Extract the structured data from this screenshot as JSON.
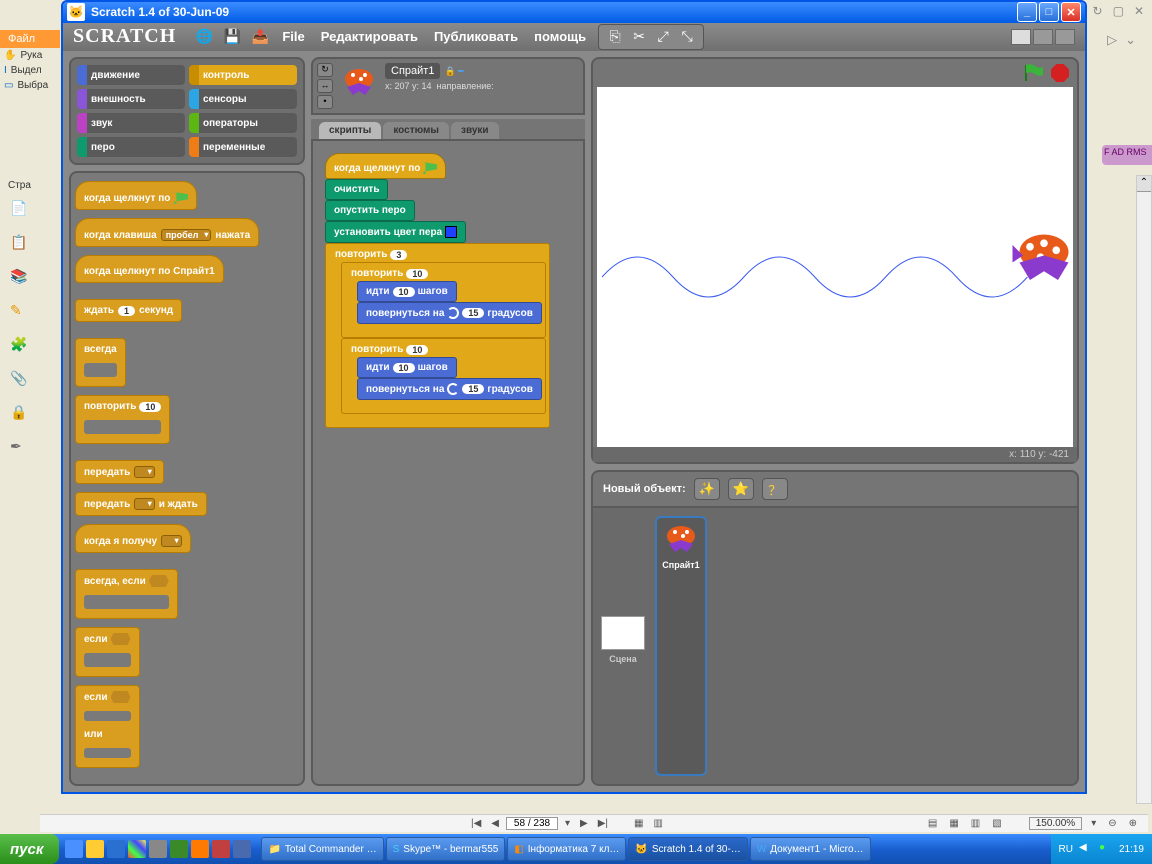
{
  "window": {
    "title": "Scratch 1.4 of 30-Jun-09"
  },
  "bg": {
    "file_tab": "Файл",
    "tools": [
      "Рука",
      "Выдел",
      "Выбра"
    ],
    "stra": "Стра",
    "right_tab": "F\nAD RMS"
  },
  "toolbar": {
    "logo": "SCRATCH",
    "menus": [
      "File",
      "Редактировать",
      "Публиковать",
      "помощь"
    ]
  },
  "categories": {
    "motion": "движение",
    "control": "контроль",
    "looks": "внешность",
    "sensing": "сенсоры",
    "sound": "звук",
    "operators": "операторы",
    "pen": "перо",
    "variables": "переменные"
  },
  "palette": {
    "when_flag": "когда щелкнут по",
    "when_key_1": "когда клавиша",
    "when_key_sel": "пробел",
    "when_key_2": "нажата",
    "when_sprite": "когда щелкнут по  Спрайт1",
    "wait_1": "ждать",
    "wait_val": "1",
    "wait_2": "секунд",
    "forever": "всегда",
    "repeat": "повторить",
    "repeat_val": "10",
    "broadcast": "передать",
    "broadcast_wait_1": "передать",
    "broadcast_wait_2": "и ждать",
    "receive": "когда я получу",
    "forever_if": "всегда, если",
    "if": "если",
    "if_else_if": "если",
    "if_else_else": "или"
  },
  "sprite": {
    "name": "Спрайт1",
    "pos": "x: 207  y: 14",
    "dir_label": "направление:"
  },
  "tabs": {
    "scripts": "скрипты",
    "costumes": "костюмы",
    "sounds": "звуки"
  },
  "script": {
    "hat": "когда щелкнут по",
    "clear": "очистить",
    "pendown": "опустить перо",
    "setcolor": "установить цвет пера",
    "repeat": "повторить",
    "r_outer": "3",
    "r_inner": "10",
    "move_1": "идти",
    "move_val": "10",
    "move_2": "шагов",
    "turn_1": "повернуться на",
    "turn_val": "15",
    "turn_2": "градусов"
  },
  "stage": {
    "coords": "x: 110     y: -421",
    "new_object": "Новый объект:",
    "stage_label": "Сцена",
    "sprite1": "Спрайт1"
  },
  "outer_bottom": {
    "page": "58 / 238",
    "zoom": "150.00%"
  },
  "taskbar": {
    "start": "пуск",
    "tasks": [
      "Total Commander …",
      "Skype™ - bermar555",
      "Інформатика 7 кл…",
      "Scratch 1.4 of 30-…",
      "Документ1 - Micro…"
    ],
    "lang": "RU",
    "time": "21:19"
  }
}
